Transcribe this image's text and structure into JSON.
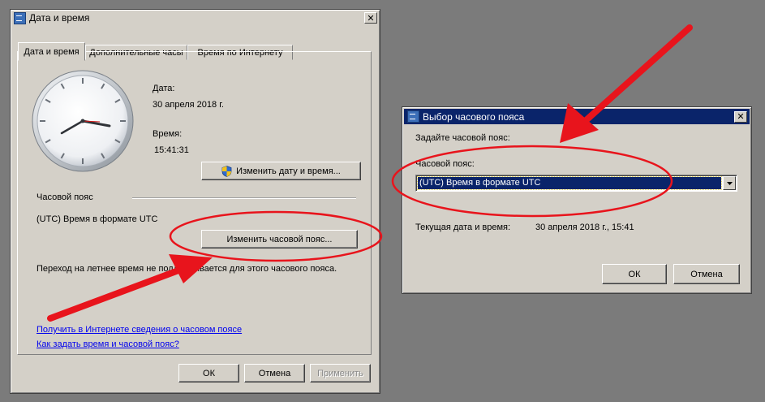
{
  "main_dialog": {
    "title": "Дата и время",
    "tabs": [
      {
        "label": "Дата и время",
        "active": true
      },
      {
        "label": "Дополнительные часы",
        "active": false
      },
      {
        "label": "Время по Интернету",
        "active": false
      }
    ],
    "date_label": "Дата:",
    "date_value": "30 апреля 2018 г.",
    "time_label": "Время:",
    "time_value": "15:41:31",
    "change_datetime_button": "Изменить дату и время...",
    "timezone_section_label": "Часовой пояс",
    "timezone_value": "(UTC) Время в формате UTC",
    "change_timezone_button": "Изменить часовой пояс...",
    "dst_notice": "Переход на летнее время не поддерживается для этого часового пояса.",
    "links": [
      "Получить в Интернете сведения о часовом поясе",
      "Как задать время и часовой пояс?"
    ],
    "buttons": {
      "ok": "ОК",
      "cancel": "Отмена",
      "apply": "Применить"
    }
  },
  "tz_dialog": {
    "title": "Выбор часового пояса",
    "prompt": "Задайте часовой пояс:",
    "timezone_label": "Часовой пояс:",
    "timezone_selected": "(UTC) Время в формате UTC",
    "current_label": "Текущая дата и время:",
    "current_value": "30 апреля 2018 г., 15:41",
    "buttons": {
      "ok": "ОК",
      "cancel": "Отмена"
    }
  },
  "colors": {
    "desktop": "#7b7b7b",
    "dialog_face": "#d4d0c8",
    "active_title": "#0a246a",
    "selection": "#0a246a",
    "annotation_red": "#e8141c",
    "link": "#0000ee"
  },
  "icons": [
    "calendar-icon",
    "close-icon",
    "uac-shield-icon",
    "dropdown-arrow-icon",
    "analog-clock"
  ]
}
